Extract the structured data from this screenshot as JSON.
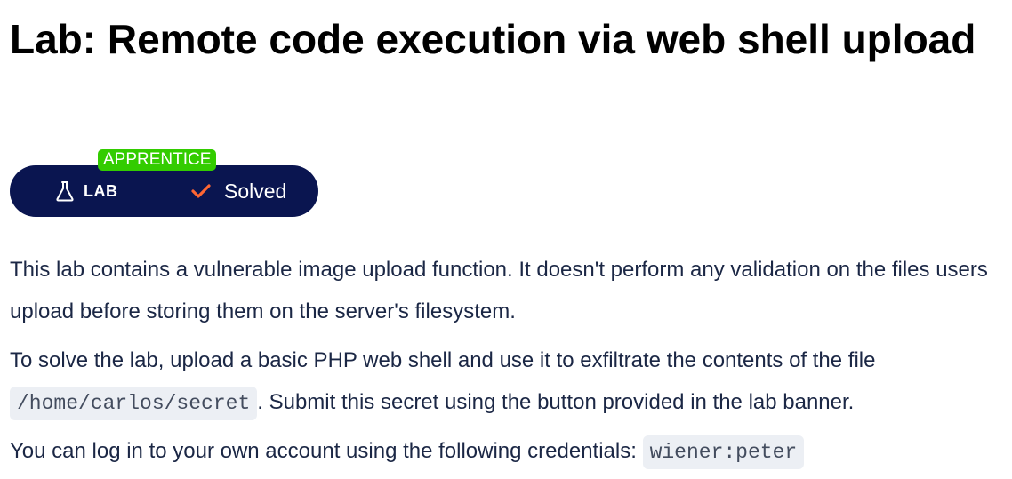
{
  "lab": {
    "title": "Lab: Remote code execution via web shell upload",
    "level": "APPRENTICE",
    "type_label": "LAB",
    "status_label": "Solved",
    "icons": {
      "type": "flask-icon",
      "status": "check-icon"
    },
    "colors": {
      "badge_bg": "#0a1550",
      "level_bg": "#33cc00",
      "check": "#ff6633"
    }
  },
  "description": {
    "p1": "This lab contains a vulnerable image upload function. It doesn't perform any validation on the files users upload before storing them on the server's filesystem.",
    "p2_before": "To solve the lab, upload a basic PHP web shell and use it to exfiltrate the contents of the file ",
    "p2_code": "/home/carlos/secret",
    "p2_after": ". Submit this secret using the button provided in the lab banner.",
    "p3_before": "You can log in to your own account using the following credentials: ",
    "p3_code": "wiener:peter"
  }
}
